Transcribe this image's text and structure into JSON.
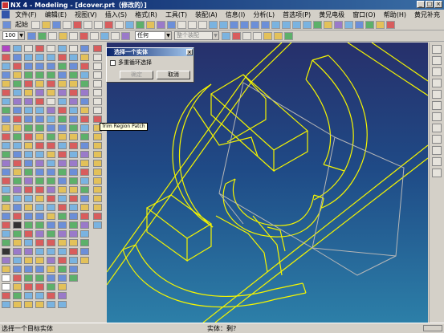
{
  "window": {
    "title": "NX 4 - Modeling - [dcover.prt（修改的）]"
  },
  "window_controls": {
    "minimize": "_",
    "maximize": "□",
    "close": "×"
  },
  "menu": {
    "items": [
      "文件(F)",
      "编辑(E)",
      "视图(V)",
      "插入(S)",
      "格式(R)",
      "工具(T)",
      "装配(A)",
      "信息(I)",
      "分析(L)",
      "首选项(P)",
      "黄兄电极",
      "窗口(O)",
      "帮助(H)",
      "黄兄补充"
    ]
  },
  "toolbar": {
    "start_label": "起始",
    "zoom_value": "100",
    "filter_value": "任何",
    "assembly_value": "整个装配"
  },
  "dialog": {
    "title": "选择一个实体",
    "close_glyph": "×",
    "checkbox_label": "多重循环选择",
    "ok_label": "确定",
    "cancel_label": "取消"
  },
  "tooltip": {
    "text": "Trim Region Patch"
  },
  "status": {
    "prompt": "选择一个目标实体",
    "selection": "实体：剩?"
  },
  "colors": {
    "wireframe": "#f5f500",
    "wireframe_gray": "#b7b7b7",
    "viewport_top": "#27306b",
    "viewport_bottom": "#2c7fa8",
    "titlebar": "#0a246a"
  }
}
